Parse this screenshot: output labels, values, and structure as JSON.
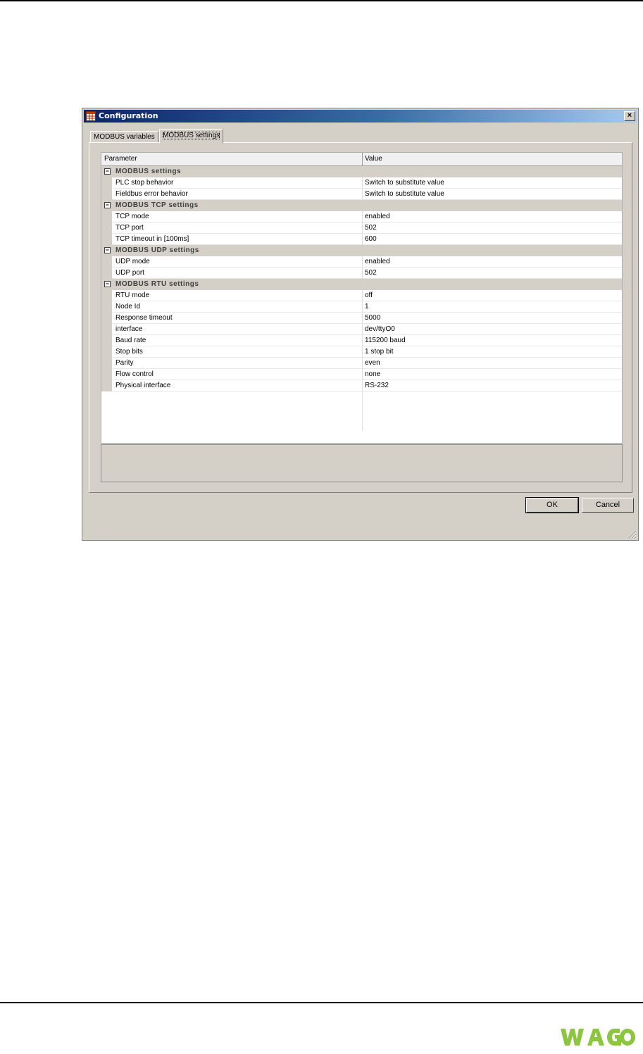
{
  "dialog": {
    "title": "Configuration",
    "close_label": "×"
  },
  "tabs": [
    {
      "label": "MODBUS variables",
      "active": false
    },
    {
      "label": "MODBUS settings",
      "active": true
    }
  ],
  "grid": {
    "header": {
      "parameter": "Parameter",
      "value": "Value"
    },
    "groups": [
      {
        "name": "MODBUS settings",
        "toggle": "−",
        "rows": [
          {
            "param": "PLC stop behavior",
            "value": "Switch to substitute value"
          },
          {
            "param": "Fieldbus error behavior",
            "value": "Switch to substitute value"
          }
        ]
      },
      {
        "name": "MODBUS TCP settings",
        "toggle": "−",
        "rows": [
          {
            "param": "TCP mode",
            "value": "enabled"
          },
          {
            "param": "TCP port",
            "value": "502"
          },
          {
            "param": "TCP timeout in [100ms]",
            "value": "600"
          }
        ]
      },
      {
        "name": "MODBUS UDP settings",
        "toggle": "−",
        "rows": [
          {
            "param": "UDP mode",
            "value": "enabled"
          },
          {
            "param": "UDP port",
            "value": "502"
          }
        ]
      },
      {
        "name": "MODBUS RTU settings",
        "toggle": "−",
        "rows": [
          {
            "param": "RTU mode",
            "value": "off"
          },
          {
            "param": "Node Id",
            "value": "1"
          },
          {
            "param": "Response timeout",
            "value": "5000"
          },
          {
            "param": "interface",
            "value": "dev/ttyO0"
          },
          {
            "param": "Baud rate",
            "value": "115200 baud"
          },
          {
            "param": "Stop bits",
            "value": "1 stop bit"
          },
          {
            "param": "Parity",
            "value": "even"
          },
          {
            "param": "Flow control",
            "value": "none"
          },
          {
            "param": "Physical interface",
            "value": "RS-232"
          }
        ]
      }
    ]
  },
  "buttons": {
    "ok": "OK",
    "cancel": "Cancel"
  },
  "logo_text": "WAGO",
  "colors": {
    "logo_green": "#8cc63f",
    "titlebar_start": "#0a246a",
    "titlebar_end": "#a6caf0"
  }
}
